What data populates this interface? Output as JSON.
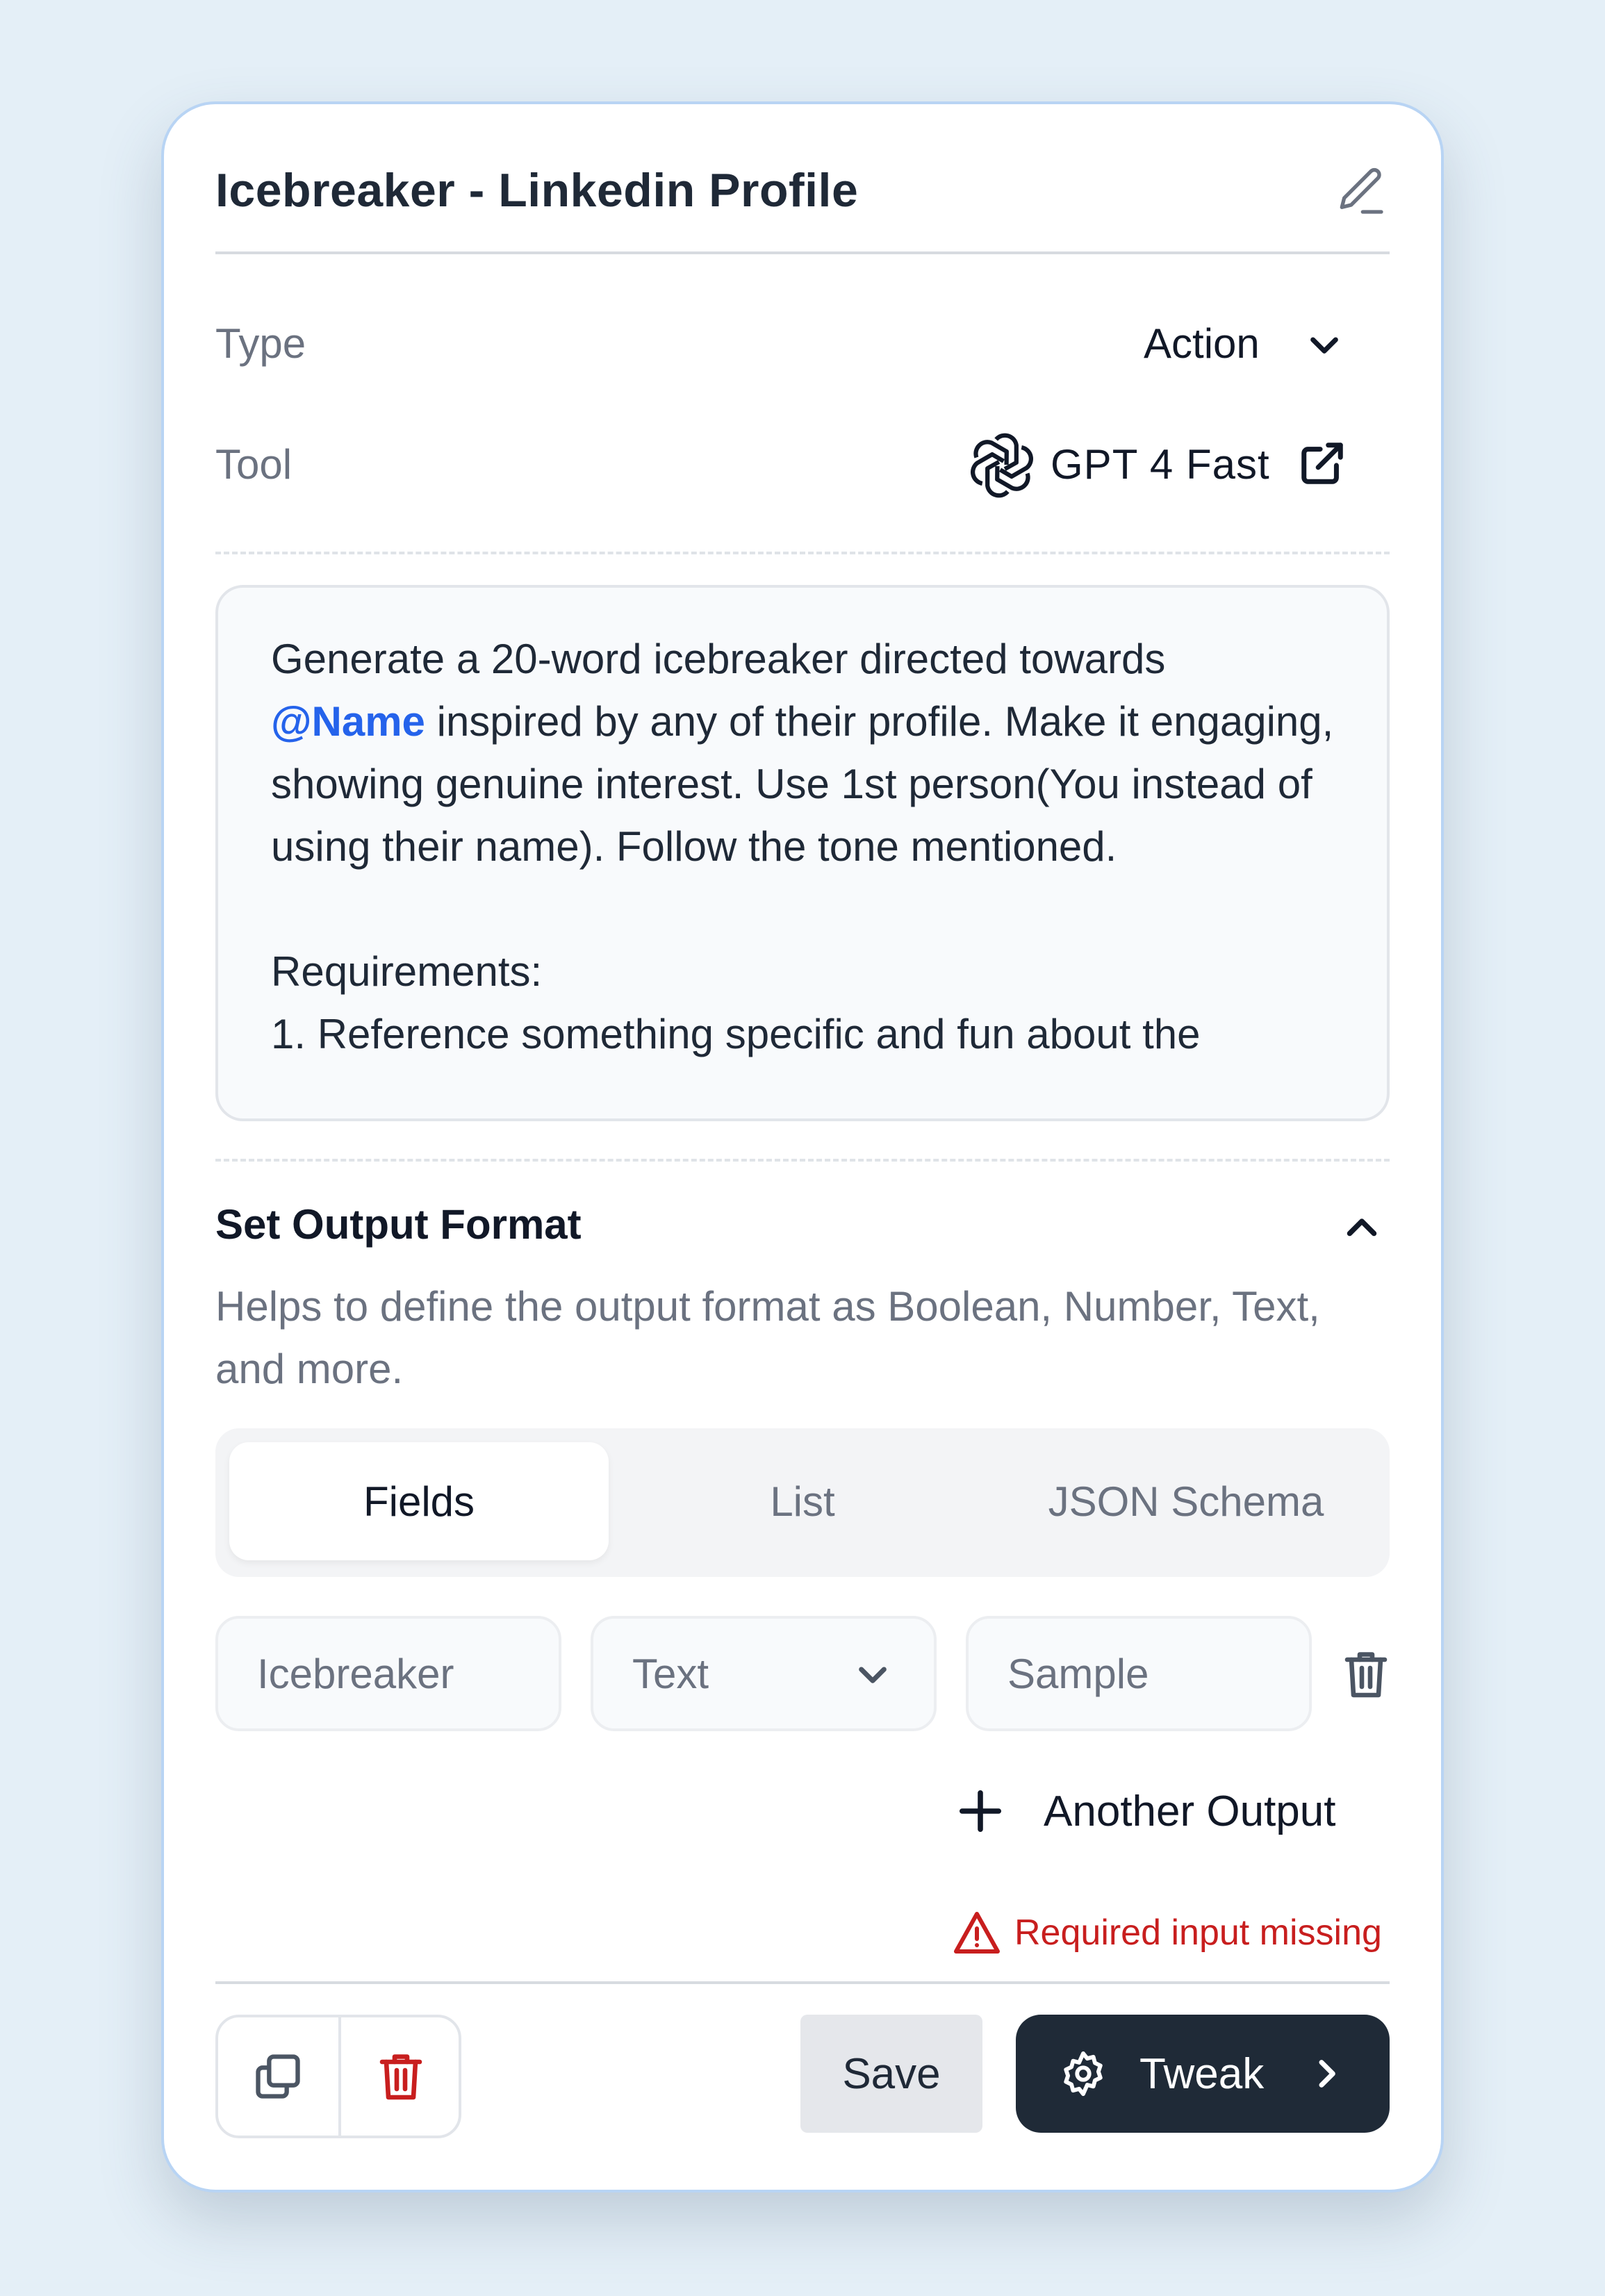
{
  "node": {
    "title": "Icebreaker - Linkedin Profile",
    "edit_icon": "pencil-icon"
  },
  "settings": {
    "type_label": "Type",
    "type_value": "Action",
    "tool_label": "Tool",
    "tool_value": "GPT 4 Fast",
    "tool_icon": "openai-icon",
    "tool_link_icon": "external-link-icon"
  },
  "prompt": {
    "line_1": "Generate a 20-word icebreaker directed towards",
    "mention": "@Name",
    "line_2_rest": " inspired by any of their profile. Make it engaging, showing genuine interest. Use 1st person(You instead of using their name). Follow the tone mentioned.",
    "requirements_heading": "Requirements:",
    "requirement_1": "1. Reference something specific and fun about the"
  },
  "output_format": {
    "title": "Set Output Format",
    "description": "Helps to define the output format as Boolean, Number, Text, and more.",
    "tabs": [
      {
        "label": "Fields",
        "active": true
      },
      {
        "label": "List",
        "active": false
      },
      {
        "label": "JSON Schema",
        "active": false
      }
    ],
    "field": {
      "name_placeholder": "Icebreaker",
      "type_value": "Text",
      "sample_placeholder": "Sample"
    },
    "add_output_label": "Another Output",
    "warning_text": "Required input missing"
  },
  "footer": {
    "save_label": "Save",
    "tweak_label": "Tweak"
  },
  "colors": {
    "accent_blue": "#2563eb",
    "error_red": "#c81e1e",
    "primary_dark": "#1f2a37",
    "card_border": "#b8d4f4"
  }
}
